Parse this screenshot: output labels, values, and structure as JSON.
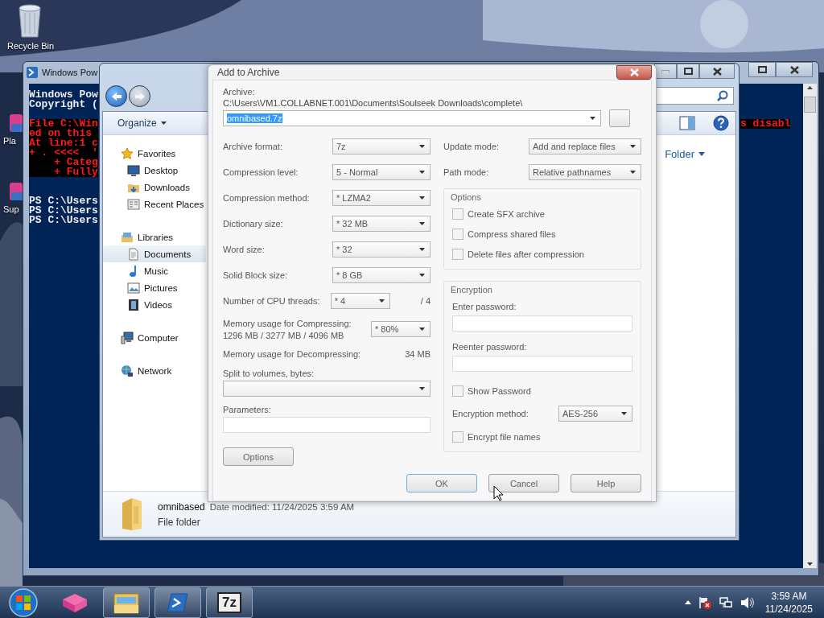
{
  "desktop_icons": [
    {
      "label": "Recycle Bin",
      "kind": "recycle"
    },
    {
      "label": "Pla",
      "kind": "app"
    },
    {
      "label": "Sup",
      "kind": "app"
    }
  ],
  "console_window": {
    "title": "Windows Pow",
    "lines": [
      {
        "kind": "output",
        "text": "Windows Pow"
      },
      {
        "kind": "output",
        "text": "Copyright ("
      },
      {
        "kind": "blank"
      },
      {
        "kind": "error",
        "text": "File C:\\Win",
        "tail": "s disabl"
      },
      {
        "kind": "error",
        "text": "ed on this "
      },
      {
        "kind": "error",
        "text": "At line:1 c"
      },
      {
        "kind": "error",
        "text": "+ . <<<<  '"
      },
      {
        "kind": "error",
        "text": "    + Categ"
      },
      {
        "kind": "error",
        "text": "    + Fully"
      },
      {
        "kind": "blank"
      },
      {
        "kind": "blank"
      },
      {
        "kind": "output",
        "text": "PS C:\\Users"
      },
      {
        "kind": "output",
        "text": "PS C:\\Users"
      },
      {
        "kind": "output",
        "text": "PS C:\\Users"
      }
    ]
  },
  "explorer": {
    "organize": "Organize",
    "sidebar": [
      {
        "label": "Favorites",
        "kind": "star",
        "selected": false,
        "children": [
          {
            "label": "Desktop",
            "kind": "desktop",
            "selected": false
          },
          {
            "label": "Downloads",
            "kind": "download",
            "selected": false
          },
          {
            "label": "Recent Places",
            "kind": "recent",
            "selected": false
          }
        ]
      },
      {
        "label": "Libraries",
        "kind": "library",
        "selected": false,
        "children": [
          {
            "label": "Documents",
            "kind": "document",
            "selected": true
          },
          {
            "label": "Music",
            "kind": "music",
            "selected": false
          },
          {
            "label": "Pictures",
            "kind": "picture",
            "selected": false
          },
          {
            "label": "Videos",
            "kind": "video",
            "selected": false
          }
        ]
      },
      {
        "label": "Computer",
        "kind": "computer",
        "selected": false
      },
      {
        "label": "Network",
        "kind": "network",
        "selected": false
      }
    ],
    "arrange_value": "Folder",
    "details": {
      "name": "omnibased",
      "date_label": "Date modified:",
      "date": "11/24/2025 3:59 AM",
      "type": "File folder"
    }
  },
  "dialog": {
    "title": "Add to Archive",
    "archive_label": "Archive:",
    "archive_path": "C:\\Users\\VM1.COLLABNET.001\\Documents\\Soulseek Downloads\\complete\\",
    "archive_name": {
      "text": "omnibased.7z",
      "highlighted": true
    },
    "left_fields": [
      {
        "kind": "combo",
        "label": "Archive format:",
        "value": "7z"
      },
      {
        "kind": "combo",
        "label": "Compression level:",
        "value": "5 - Normal"
      },
      {
        "kind": "combo",
        "label": "Compression method:",
        "value": "* LZMA2"
      },
      {
        "kind": "combo",
        "label": "Dictionary size:",
        "value": "* 32 MB"
      },
      {
        "kind": "combo",
        "label": "Word size:",
        "value": "* 32"
      },
      {
        "kind": "combo",
        "label": "Solid Block size:",
        "value": "* 8 GB"
      },
      {
        "kind": "short",
        "label": "Number of CPU threads:",
        "value": "* 4",
        "suffix": "/ 4"
      },
      {
        "kind": "memory",
        "label": "Memory usage for Compressing:",
        "sublabel": "1296 MB / 3277 MB / 4096 MB",
        "value": "* 80%"
      },
      {
        "kind": "info",
        "label": "Memory usage for Decompressing:",
        "suffix": "34 MB"
      },
      {
        "kind": "wide-combo",
        "label": "Split to volumes, bytes:"
      },
      {
        "kind": "wide-field",
        "label": "Parameters:"
      }
    ],
    "options_button": "Options",
    "right_fields": [
      {
        "label": "Update mode:",
        "value": "Add and replace files"
      },
      {
        "label": "Path mode:",
        "value": "Relative pathnames"
      }
    ],
    "options_group": {
      "title": "Options",
      "checkboxes": [
        {
          "label": "Create SFX archive",
          "checked": false
        },
        {
          "label": "Compress shared files",
          "checked": false
        },
        {
          "label": "Delete files after compression",
          "checked": false
        }
      ]
    },
    "encryption": {
      "title": "Encryption",
      "password_label": "Enter password:",
      "reenter_label": "Reenter password:",
      "show_password": {
        "label": "Show Password",
        "checked": false
      },
      "method": {
        "label": "Encryption method:",
        "value": "AES-256"
      },
      "encrypt_names": {
        "label": "Encrypt file names",
        "checked": false
      }
    },
    "buttons": [
      {
        "label": "OK",
        "kind": "default"
      },
      {
        "label": "Cancel",
        "kind": "normal"
      },
      {
        "label": "Help",
        "kind": "normal"
      }
    ]
  },
  "taskbar": {
    "apps": [
      {
        "kind": "cube",
        "running": false
      },
      {
        "kind": "explorer",
        "running": true
      },
      {
        "kind": "powershell",
        "running": true
      },
      {
        "kind": "sevenzip",
        "running": true,
        "label": "7z"
      }
    ],
    "clock": {
      "time": "3:59 AM",
      "date": "11/24/2025"
    }
  }
}
